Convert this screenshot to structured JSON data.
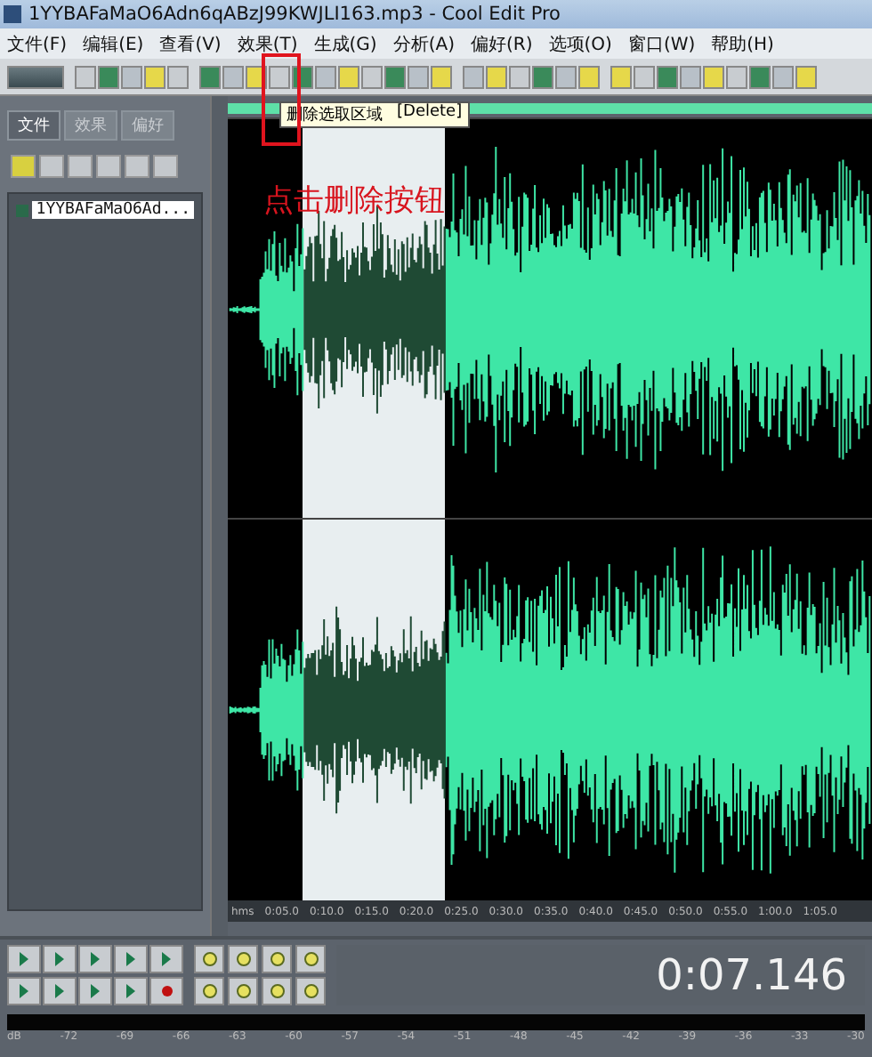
{
  "window": {
    "title": "1YYBAFaMaO6Adn6qABzJ99KWJLI163.mp3 - Cool Edit Pro"
  },
  "menu": [
    "文件(F)",
    "编辑(E)",
    "查看(V)",
    "效果(T)",
    "生成(G)",
    "分析(A)",
    "偏好(R)",
    "选项(O)",
    "窗口(W)",
    "帮助(H)"
  ],
  "tooltip": {
    "text": "删除选取区域",
    "shortcut": "[Delete]"
  },
  "annotation": {
    "text": "点击删除按钮"
  },
  "left_panel": {
    "tabs": [
      {
        "label": "文件",
        "selected": true
      },
      {
        "label": "效果",
        "selected": false
      },
      {
        "label": "偏好",
        "selected": false
      }
    ],
    "files": [
      {
        "name": "1YYBAFaMaO6Ad...",
        "selected": true
      }
    ]
  },
  "time_ruler": [
    "hms",
    "0:05.0",
    "0:10.0",
    "0:15.0",
    "0:20.0",
    "0:25.0",
    "0:30.0",
    "0:35.0",
    "0:40.0",
    "0:45.0",
    "0:50.0",
    "0:55.0",
    "1:00.0",
    "1:05.0"
  ],
  "time_display": "0:07.146",
  "meter_scale": [
    "dB",
    "-72",
    "-69",
    "-66",
    "-63",
    "-60",
    "-57",
    "-54",
    "-51",
    "-48",
    "-45",
    "-42",
    "-39",
    "-36",
    "-33",
    "-30"
  ]
}
